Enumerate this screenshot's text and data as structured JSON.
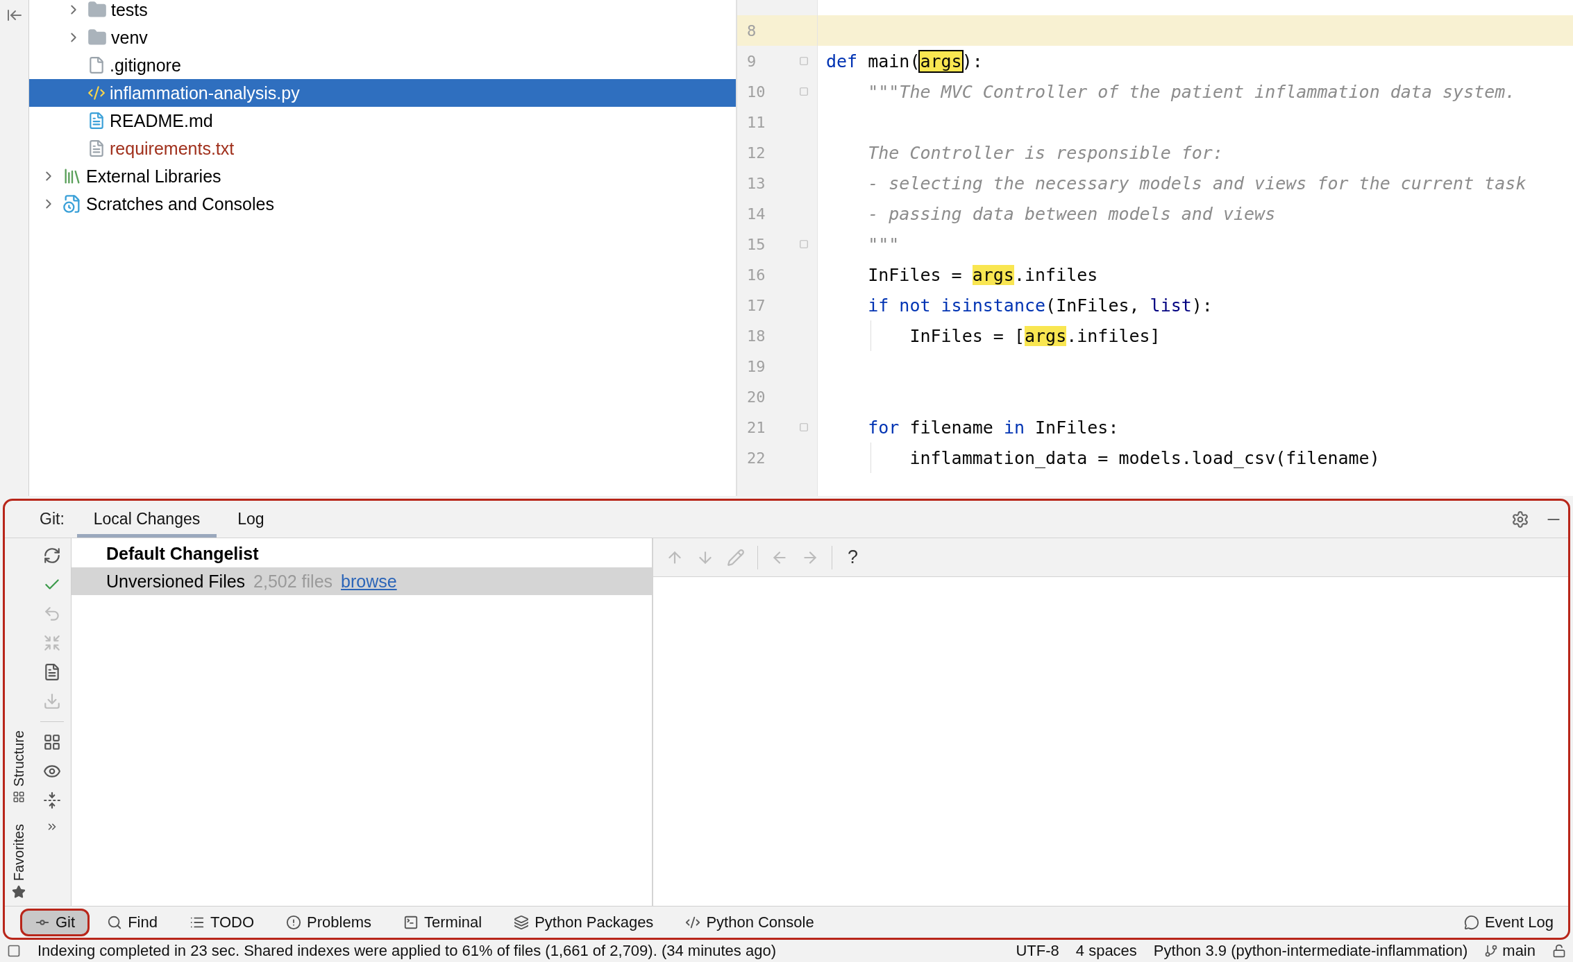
{
  "project_tree": [
    {
      "name": "tests",
      "kind": "folder",
      "expandable": true,
      "selected": false,
      "unversioned": false
    },
    {
      "name": "venv",
      "kind": "folder",
      "expandable": true,
      "selected": false,
      "unversioned": false
    },
    {
      "name": ".gitignore",
      "kind": "ignore",
      "expandable": false,
      "selected": false,
      "unversioned": false
    },
    {
      "name": "inflammation-analysis.py",
      "kind": "python",
      "expandable": false,
      "selected": true,
      "unversioned": false
    },
    {
      "name": "README.md",
      "kind": "markdown",
      "expandable": false,
      "selected": false,
      "unversioned": false
    },
    {
      "name": "requirements.txt",
      "kind": "text",
      "expandable": false,
      "selected": false,
      "unversioned": true
    }
  ],
  "project_roots": [
    {
      "name": "External Libraries",
      "kind": "libraries",
      "expandable": true,
      "selected": false
    },
    {
      "name": "Scratches and Consoles",
      "kind": "scratches",
      "expandable": true,
      "selected": false
    }
  ],
  "editor": {
    "lines": [
      {
        "number": "8",
        "current": true,
        "fold": false,
        "guide": false
      },
      {
        "number": "9",
        "current": false,
        "fold": true,
        "guide": false,
        "tokens": [
          {
            "kind": "keyword",
            "text": "def"
          },
          {
            "kind": "plain",
            "text": " main("
          },
          {
            "kind": "match",
            "text": "args"
          },
          {
            "kind": "plain",
            "text": "):"
          }
        ]
      },
      {
        "number": "10",
        "current": false,
        "fold": true,
        "guide": false,
        "tokens": [
          {
            "kind": "doc",
            "text": "    \"\"\"The MVC Controller of the patient inflammation data system."
          }
        ]
      },
      {
        "number": "11",
        "current": false,
        "fold": false,
        "guide": false
      },
      {
        "number": "12",
        "current": false,
        "fold": false,
        "guide": false,
        "tokens": [
          {
            "kind": "doc",
            "text": "    The Controller is responsible for:"
          }
        ]
      },
      {
        "number": "13",
        "current": false,
        "fold": false,
        "guide": false,
        "tokens": [
          {
            "kind": "doc",
            "text": "    - selecting the necessary models and views for the current task"
          }
        ]
      },
      {
        "number": "14",
        "current": false,
        "fold": false,
        "guide": false,
        "tokens": [
          {
            "kind": "doc",
            "text": "    - passing data between models and views"
          }
        ]
      },
      {
        "number": "15",
        "current": false,
        "fold": true,
        "guide": false,
        "tokens": [
          {
            "kind": "doc",
            "text": "    \"\"\""
          }
        ]
      },
      {
        "number": "16",
        "current": false,
        "fold": false,
        "guide": false,
        "tokens": [
          {
            "kind": "plain",
            "text": "    InFiles = "
          },
          {
            "kind": "usage",
            "text": "args"
          },
          {
            "kind": "plain",
            "text": ".infiles"
          }
        ]
      },
      {
        "number": "17",
        "current": false,
        "fold": false,
        "guide": false,
        "tokens": [
          {
            "kind": "keyword",
            "text": "    if not isinstance"
          },
          {
            "kind": "plain",
            "text": "(InFiles, "
          },
          {
            "kind": "builtin",
            "text": "list"
          },
          {
            "kind": "plain",
            "text": "):"
          }
        ]
      },
      {
        "number": "18",
        "current": false,
        "fold": false,
        "guide": true,
        "tokens": [
          {
            "kind": "plain",
            "text": "        InFiles = ["
          },
          {
            "kind": "usage",
            "text": "args"
          },
          {
            "kind": "plain",
            "text": ".infiles]"
          }
        ]
      },
      {
        "number": "19",
        "current": false,
        "fold": false,
        "guide": false
      },
      {
        "number": "20",
        "current": false,
        "fold": false,
        "guide": false
      },
      {
        "number": "21",
        "current": false,
        "fold": true,
        "guide": false,
        "tokens": [
          {
            "kind": "keyword",
            "text": "    for"
          },
          {
            "kind": "plain",
            "text": " filename "
          },
          {
            "kind": "keyword",
            "text": "in"
          },
          {
            "kind": "plain",
            "text": " InFiles:"
          }
        ]
      },
      {
        "number": "22",
        "current": false,
        "fold": false,
        "guide": true,
        "tokens": [
          {
            "kind": "plain",
            "text": "        inflammation_data = models.load_csv(filename)"
          }
        ]
      }
    ]
  },
  "side_labels": [
    {
      "label": "Structure",
      "kind": "structure"
    },
    {
      "label": "Favorites",
      "kind": "favorites"
    }
  ],
  "git_panel": {
    "prefix": "Git:",
    "tabs": [
      {
        "label": "Local Changes",
        "selected": true
      },
      {
        "label": "Log",
        "selected": false
      }
    ],
    "toolbar": [
      {
        "kind": "refresh",
        "disabled": false
      },
      {
        "kind": "commit",
        "disabled": false
      },
      {
        "kind": "rollback",
        "disabled": true
      },
      {
        "kind": "merge",
        "disabled": true
      },
      {
        "kind": "message",
        "disabled": false
      },
      {
        "kind": "shelve",
        "disabled": true
      },
      {
        "kind": "separator"
      },
      {
        "kind": "group",
        "disabled": false
      },
      {
        "kind": "view",
        "disabled": false
      },
      {
        "kind": "expand",
        "disabled": false
      },
      {
        "kind": "more",
        "disabled": false
      }
    ],
    "changelist": {
      "title": "Default Changelist",
      "rows": [
        {
          "name": "Unversioned Files",
          "count": "2,502 files",
          "link": "browse",
          "selected": true
        }
      ]
    },
    "diff_toolbar": [
      {
        "kind": "up",
        "disabled": true
      },
      {
        "kind": "down",
        "disabled": true
      },
      {
        "kind": "edit",
        "disabled": true
      },
      {
        "kind": "separator"
      },
      {
        "kind": "back",
        "disabled": true
      },
      {
        "kind": "forward",
        "disabled": true
      },
      {
        "kind": "separator"
      },
      {
        "kind": "help",
        "text": "?",
        "disabled": false
      }
    ]
  },
  "tool_windows": [
    {
      "label": "Git",
      "kind": "git",
      "selected": true
    },
    {
      "label": "Find",
      "kind": "find",
      "selected": false
    },
    {
      "label": "TODO",
      "kind": "todo",
      "selected": false
    },
    {
      "label": "Problems",
      "kind": "problems",
      "selected": false
    },
    {
      "label": "Terminal",
      "kind": "terminal",
      "selected": false
    },
    {
      "label": "Python Packages",
      "kind": "packages",
      "selected": false
    },
    {
      "label": "Python Console",
      "kind": "console",
      "selected": false
    }
  ],
  "event_log": "Event Log",
  "status_bar": {
    "message": "Indexing completed in 23 sec. Shared indexes were applied to 61% of files (1,661 of 2,709). (34 minutes ago)",
    "encoding": "UTF-8",
    "indent": "4 spaces",
    "interpreter": "Python 3.9 (python-intermediate-inflammation)",
    "branch": "main"
  }
}
